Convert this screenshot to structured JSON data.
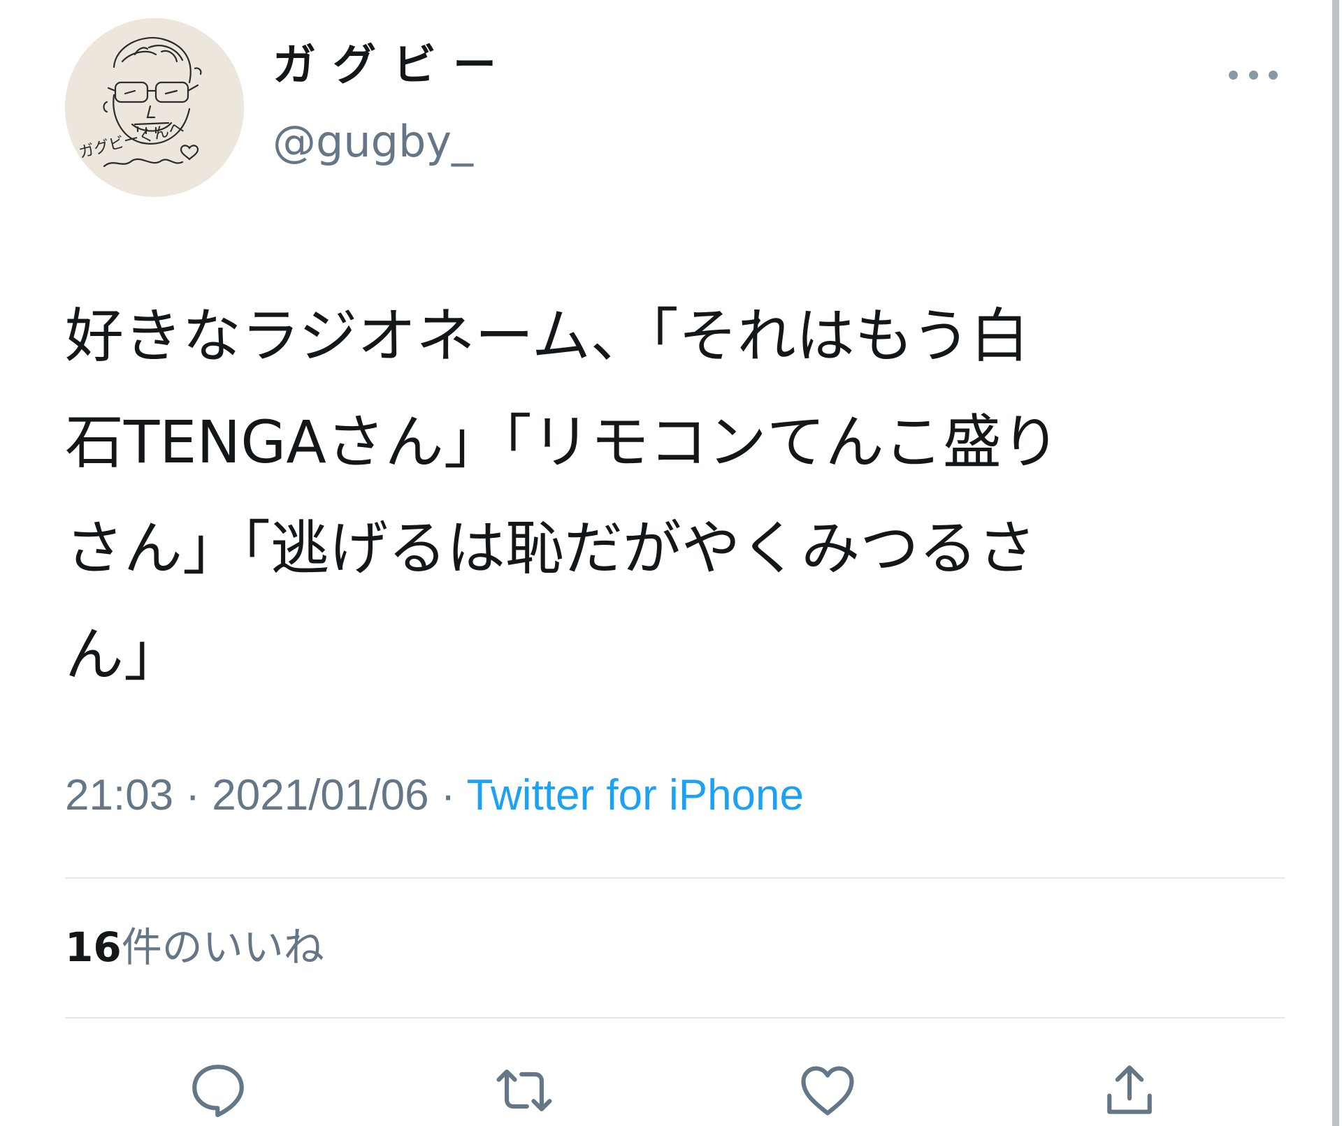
{
  "tweet": {
    "display_name": "ガグビー",
    "handle": "@gugby_",
    "text": "好きなラジオネーム、「それはもう白\n石TENGAさん」「リモコンてんこ盛り\nさん」「逃げるは恥だがやくみつるさ\nん」",
    "time": "21:03",
    "date": "2021/01/06",
    "separator": " · ",
    "source": "Twitter for iPhone",
    "likes_count": "16",
    "likes_label": "件のいいね",
    "avatar_signature": "ガグビーくんへ"
  },
  "icons": {
    "more": "more-horizontal-icon",
    "reply": "reply-icon",
    "retweet": "retweet-icon",
    "like": "heart-icon",
    "share": "share-icon"
  },
  "colors": {
    "text": "#14171a",
    "secondary": "#657786",
    "link": "#1da1f2",
    "icon": "#657786",
    "divider": "#e1e8ed"
  }
}
